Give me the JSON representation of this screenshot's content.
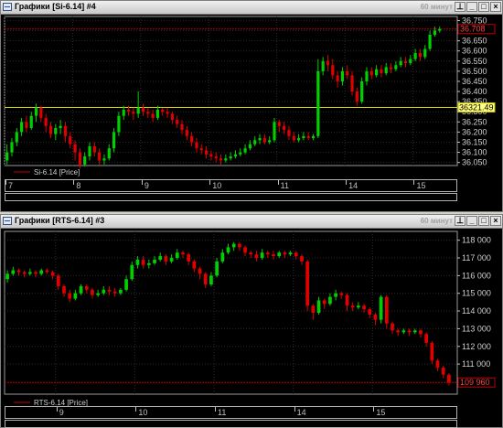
{
  "windows": [
    {
      "title": "Графики [Si-6.14] #4",
      "timeframe": "60 минут",
      "chart_data": {
        "type": "candlestick",
        "symbol": "Si-6.14",
        "legend": "Si-6.14 [Price]",
        "y_ticks": [
          36050,
          36100,
          36150,
          36200,
          36250,
          36300,
          36350,
          36400,
          36450,
          36500,
          36550,
          36600,
          36650,
          36700,
          36750
        ],
        "y_tick_labels": [
          "36.050",
          "36.100",
          "36.150",
          "36.200",
          "36.250",
          "36.300",
          "36.350",
          "36.400",
          "36.450",
          "36.500",
          "36.550",
          "36.600",
          "36.650",
          "36.700",
          "36.750"
        ],
        "ylim": [
          36035,
          36770
        ],
        "x_labels": [
          "7",
          "8",
          "9",
          "10",
          "11",
          "14",
          "15"
        ],
        "day_starts": [
          0,
          14,
          28,
          42,
          56,
          70,
          84
        ],
        "last_price_label": "36.708",
        "last_price": 36708,
        "horizontal_line_label": "36321.49",
        "horizontal_line": 36321.49,
        "candles": [
          [
            36060,
            36100,
            36040,
            36140
          ],
          [
            36100,
            36150,
            36080,
            36170
          ],
          [
            36150,
            36200,
            36130,
            36220
          ],
          [
            36200,
            36250,
            36180,
            36270
          ],
          [
            36250,
            36220,
            36200,
            36280
          ],
          [
            36220,
            36280,
            36210,
            36300
          ],
          [
            36280,
            36320,
            36250,
            36340
          ],
          [
            36320,
            36270,
            36250,
            36330
          ],
          [
            36270,
            36230,
            36200,
            36290
          ],
          [
            36230,
            36190,
            36170,
            36250
          ],
          [
            36190,
            36220,
            36160,
            36240
          ],
          [
            36220,
            36230,
            36190,
            36260
          ],
          [
            36230,
            36180,
            36150,
            36250
          ],
          [
            36180,
            36140,
            36120,
            36200
          ],
          [
            36140,
            36100,
            36060,
            36160
          ],
          [
            36100,
            36040,
            36020,
            36120
          ],
          [
            36040,
            36080,
            36030,
            36100
          ],
          [
            36080,
            36130,
            36060,
            36150
          ],
          [
            36130,
            36100,
            36080,
            36150
          ],
          [
            36100,
            36060,
            36040,
            36120
          ],
          [
            36060,
            36070,
            36040,
            36090
          ],
          [
            36070,
            36120,
            36060,
            36140
          ],
          [
            36120,
            36200,
            36100,
            36220
          ],
          [
            36200,
            36280,
            36180,
            36300
          ],
          [
            36280,
            36310,
            36260,
            36330
          ],
          [
            36310,
            36300,
            36280,
            36330
          ],
          [
            36300,
            36290,
            36260,
            36320
          ],
          [
            36290,
            36320,
            36270,
            36400
          ],
          [
            36320,
            36300,
            36280,
            36340
          ],
          [
            36300,
            36290,
            36270,
            36320
          ],
          [
            36290,
            36270,
            36250,
            36310
          ],
          [
            36270,
            36310,
            36260,
            36330
          ],
          [
            36310,
            36300,
            36280,
            36320
          ],
          [
            36300,
            36290,
            36270,
            36320
          ],
          [
            36290,
            36260,
            36240,
            36300
          ],
          [
            36260,
            36240,
            36220,
            36280
          ],
          [
            36240,
            36210,
            36190,
            36260
          ],
          [
            36210,
            36180,
            36160,
            36230
          ],
          [
            36180,
            36150,
            36130,
            36200
          ],
          [
            36150,
            36120,
            36100,
            36170
          ],
          [
            36120,
            36110,
            36090,
            36140
          ],
          [
            36110,
            36090,
            36070,
            36130
          ],
          [
            36090,
            36080,
            36060,
            36110
          ],
          [
            36080,
            36070,
            36050,
            36100
          ],
          [
            36070,
            36060,
            36040,
            36090
          ],
          [
            36060,
            36070,
            36050,
            36090
          ],
          [
            36070,
            36080,
            36060,
            36100
          ],
          [
            36080,
            36090,
            36070,
            36110
          ],
          [
            36090,
            36100,
            36080,
            36120
          ],
          [
            36100,
            36120,
            36090,
            36140
          ],
          [
            36120,
            36140,
            36110,
            36160
          ],
          [
            36140,
            36160,
            36130,
            36180
          ],
          [
            36160,
            36170,
            36140,
            36190
          ],
          [
            36170,
            36150,
            36140,
            36190
          ],
          [
            36150,
            36160,
            36140,
            36180
          ],
          [
            36160,
            36250,
            36150,
            36270
          ],
          [
            36250,
            36230,
            36200,
            36260
          ],
          [
            36230,
            36210,
            36190,
            36250
          ],
          [
            36210,
            36180,
            36160,
            36230
          ],
          [
            36180,
            36160,
            36150,
            36200
          ],
          [
            36160,
            36170,
            36150,
            36190
          ],
          [
            36170,
            36180,
            36160,
            36200
          ],
          [
            36180,
            36170,
            36160,
            36200
          ],
          [
            36170,
            36180,
            36160,
            36190
          ],
          [
            36180,
            36500,
            36170,
            36560
          ],
          [
            36500,
            36550,
            36480,
            36570
          ],
          [
            36550,
            36530,
            36500,
            36580
          ],
          [
            36530,
            36480,
            36460,
            36560
          ],
          [
            36480,
            36450,
            36420,
            36500
          ],
          [
            36450,
            36500,
            36430,
            36520
          ],
          [
            36500,
            36480,
            36460,
            36530
          ],
          [
            36480,
            36400,
            36380,
            36500
          ],
          [
            36400,
            36350,
            36330,
            36420
          ],
          [
            36350,
            36450,
            36340,
            36470
          ],
          [
            36450,
            36500,
            36430,
            36520
          ],
          [
            36500,
            36480,
            36460,
            36520
          ],
          [
            36480,
            36510,
            36470,
            36530
          ],
          [
            36510,
            36490,
            36470,
            36530
          ],
          [
            36490,
            36520,
            36480,
            36540
          ],
          [
            36520,
            36510,
            36490,
            36540
          ],
          [
            36510,
            36530,
            36500,
            36550
          ],
          [
            36530,
            36550,
            36520,
            36570
          ],
          [
            36550,
            36540,
            36520,
            36570
          ],
          [
            36540,
            36560,
            36530,
            36580
          ],
          [
            36560,
            36590,
            36550,
            36610
          ],
          [
            36590,
            36570,
            36550,
            36610
          ],
          [
            36570,
            36610,
            36560,
            36630
          ],
          [
            36610,
            36680,
            36600,
            36700
          ],
          [
            36680,
            36700,
            36670,
            36720
          ],
          [
            36700,
            36708,
            36690,
            36720
          ]
        ]
      }
    },
    {
      "title": "Графики [RTS-6.14] #3",
      "timeframe": "60 минут",
      "chart_data": {
        "type": "candlestick",
        "symbol": "RTS-6.14",
        "legend": "RTS-6.14 [Price]",
        "y_ticks": [
          111000,
          112000,
          113000,
          114000,
          115000,
          116000,
          117000,
          118000
        ],
        "y_tick_labels": [
          "111 000",
          "112 000",
          "113 000",
          "114 000",
          "115 000",
          "116 000",
          "117 000",
          "118 000"
        ],
        "ylim": [
          109300,
          118500
        ],
        "x_labels": [
          "9",
          "10",
          "11",
          "14",
          "15"
        ],
        "day_starts": [
          9,
          23,
          37,
          51,
          65
        ],
        "last_price_label": "109 960",
        "last_price": 109960,
        "candles": [
          [
            115800,
            116100,
            115600,
            116300
          ],
          [
            116100,
            116300,
            116000,
            116500
          ],
          [
            116300,
            116200,
            116000,
            116400
          ],
          [
            116200,
            116100,
            115900,
            116300
          ],
          [
            116100,
            116200,
            116000,
            116400
          ],
          [
            116200,
            116100,
            115900,
            116300
          ],
          [
            116100,
            116300,
            116000,
            116400
          ],
          [
            116300,
            116200,
            116100,
            116400
          ],
          [
            116200,
            116000,
            115800,
            116300
          ],
          [
            116000,
            115400,
            115200,
            116100
          ],
          [
            115400,
            115000,
            114800,
            115500
          ],
          [
            115000,
            114700,
            114500,
            115200
          ],
          [
            114700,
            115000,
            114600,
            115200
          ],
          [
            115000,
            115400,
            114900,
            115500
          ],
          [
            115400,
            115200,
            115000,
            115500
          ],
          [
            115200,
            114900,
            114700,
            115300
          ],
          [
            114900,
            115000,
            114800,
            115200
          ],
          [
            115000,
            115200,
            114900,
            115400
          ],
          [
            115200,
            115100,
            114900,
            115400
          ],
          [
            115100,
            115000,
            114800,
            115300
          ],
          [
            115000,
            115200,
            114900,
            115300
          ],
          [
            115200,
            115800,
            115100,
            116000
          ],
          [
            115800,
            116600,
            115700,
            116800
          ],
          [
            116600,
            116900,
            116400,
            117100
          ],
          [
            116900,
            116600,
            116400,
            117100
          ],
          [
            116600,
            116700,
            116400,
            116900
          ],
          [
            116700,
            116900,
            116600,
            117100
          ],
          [
            116900,
            117100,
            116800,
            117300
          ],
          [
            117100,
            116800,
            116600,
            117200
          ],
          [
            116800,
            117000,
            116700,
            117200
          ],
          [
            117000,
            117300,
            116900,
            117500
          ],
          [
            117300,
            117200,
            117000,
            117400
          ],
          [
            117200,
            116800,
            116600,
            117300
          ],
          [
            116800,
            116400,
            116200,
            116900
          ],
          [
            116400,
            116100,
            115800,
            116500
          ],
          [
            116100,
            115500,
            115300,
            116200
          ],
          [
            115500,
            116000,
            115400,
            116200
          ],
          [
            116000,
            116800,
            115900,
            117000
          ],
          [
            116800,
            117300,
            116700,
            117500
          ],
          [
            117300,
            117600,
            117200,
            117800
          ],
          [
            117600,
            117800,
            117400,
            117900
          ],
          [
            117800,
            117600,
            117400,
            117900
          ],
          [
            117600,
            117300,
            117100,
            117700
          ],
          [
            117300,
            117200,
            117000,
            117400
          ],
          [
            117200,
            117000,
            116800,
            117400
          ],
          [
            117000,
            117300,
            116900,
            117500
          ],
          [
            117300,
            117200,
            117000,
            117400
          ],
          [
            117200,
            117100,
            116900,
            117400
          ],
          [
            117100,
            117300,
            117000,
            117400
          ],
          [
            117300,
            117200,
            117000,
            117400
          ],
          [
            117200,
            117300,
            117100,
            117400
          ],
          [
            117300,
            117100,
            116900,
            117400
          ],
          [
            117100,
            116800,
            116600,
            117200
          ],
          [
            116800,
            114300,
            114000,
            116900
          ],
          [
            114300,
            113900,
            113500,
            114400
          ],
          [
            113900,
            114600,
            113800,
            114800
          ],
          [
            114600,
            114400,
            114100,
            114700
          ],
          [
            114400,
            114800,
            114300,
            115000
          ],
          [
            114800,
            115000,
            114600,
            115200
          ],
          [
            115000,
            114900,
            114700,
            115100
          ],
          [
            114900,
            114300,
            114000,
            115000
          ],
          [
            114300,
            114200,
            114000,
            114500
          ],
          [
            114200,
            114300,
            114100,
            114500
          ],
          [
            114300,
            114100,
            113900,
            114400
          ],
          [
            114100,
            113800,
            113600,
            114200
          ],
          [
            113800,
            113500,
            113200,
            113900
          ],
          [
            113500,
            114800,
            113300,
            114900
          ],
          [
            114800,
            113300,
            113000,
            114900
          ],
          [
            113300,
            112900,
            112700,
            113400
          ],
          [
            112900,
            112800,
            112600,
            113000
          ],
          [
            112800,
            112900,
            112700,
            113000
          ],
          [
            112900,
            112800,
            112600,
            113000
          ],
          [
            112800,
            112900,
            112700,
            113000
          ],
          [
            112900,
            112700,
            112500,
            113000
          ],
          [
            112700,
            112200,
            112000,
            112800
          ],
          [
            112200,
            111200,
            111000,
            112300
          ],
          [
            111200,
            110800,
            110600,
            111300
          ],
          [
            110800,
            110400,
            110200,
            110900
          ],
          [
            110400,
            109960,
            109800,
            110500
          ]
        ]
      }
    }
  ]
}
